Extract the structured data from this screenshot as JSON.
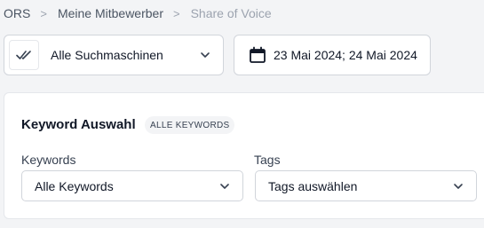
{
  "breadcrumb": {
    "items": [
      "ORS",
      "Meine Mitbewerber",
      "Share of Voice"
    ],
    "separator": ">"
  },
  "filters": {
    "search_engine": {
      "selected": "Alle Suchmaschinen",
      "icon": "double-check-icon"
    },
    "date_range": {
      "value": "23 Mai 2024; 24 Mai 2024",
      "icon": "calendar-icon"
    }
  },
  "keyword_selection": {
    "title": "Keyword Auswahl",
    "badge": "ALLE KEYWORDS",
    "keywords": {
      "label": "Keywords",
      "selected": "Alle Keywords"
    },
    "tags": {
      "label": "Tags",
      "placeholder": "Tags auswählen"
    }
  },
  "colors": {
    "page_background": "#f3f4f6",
    "card_background": "#ffffff",
    "border": "#d1d5db"
  }
}
